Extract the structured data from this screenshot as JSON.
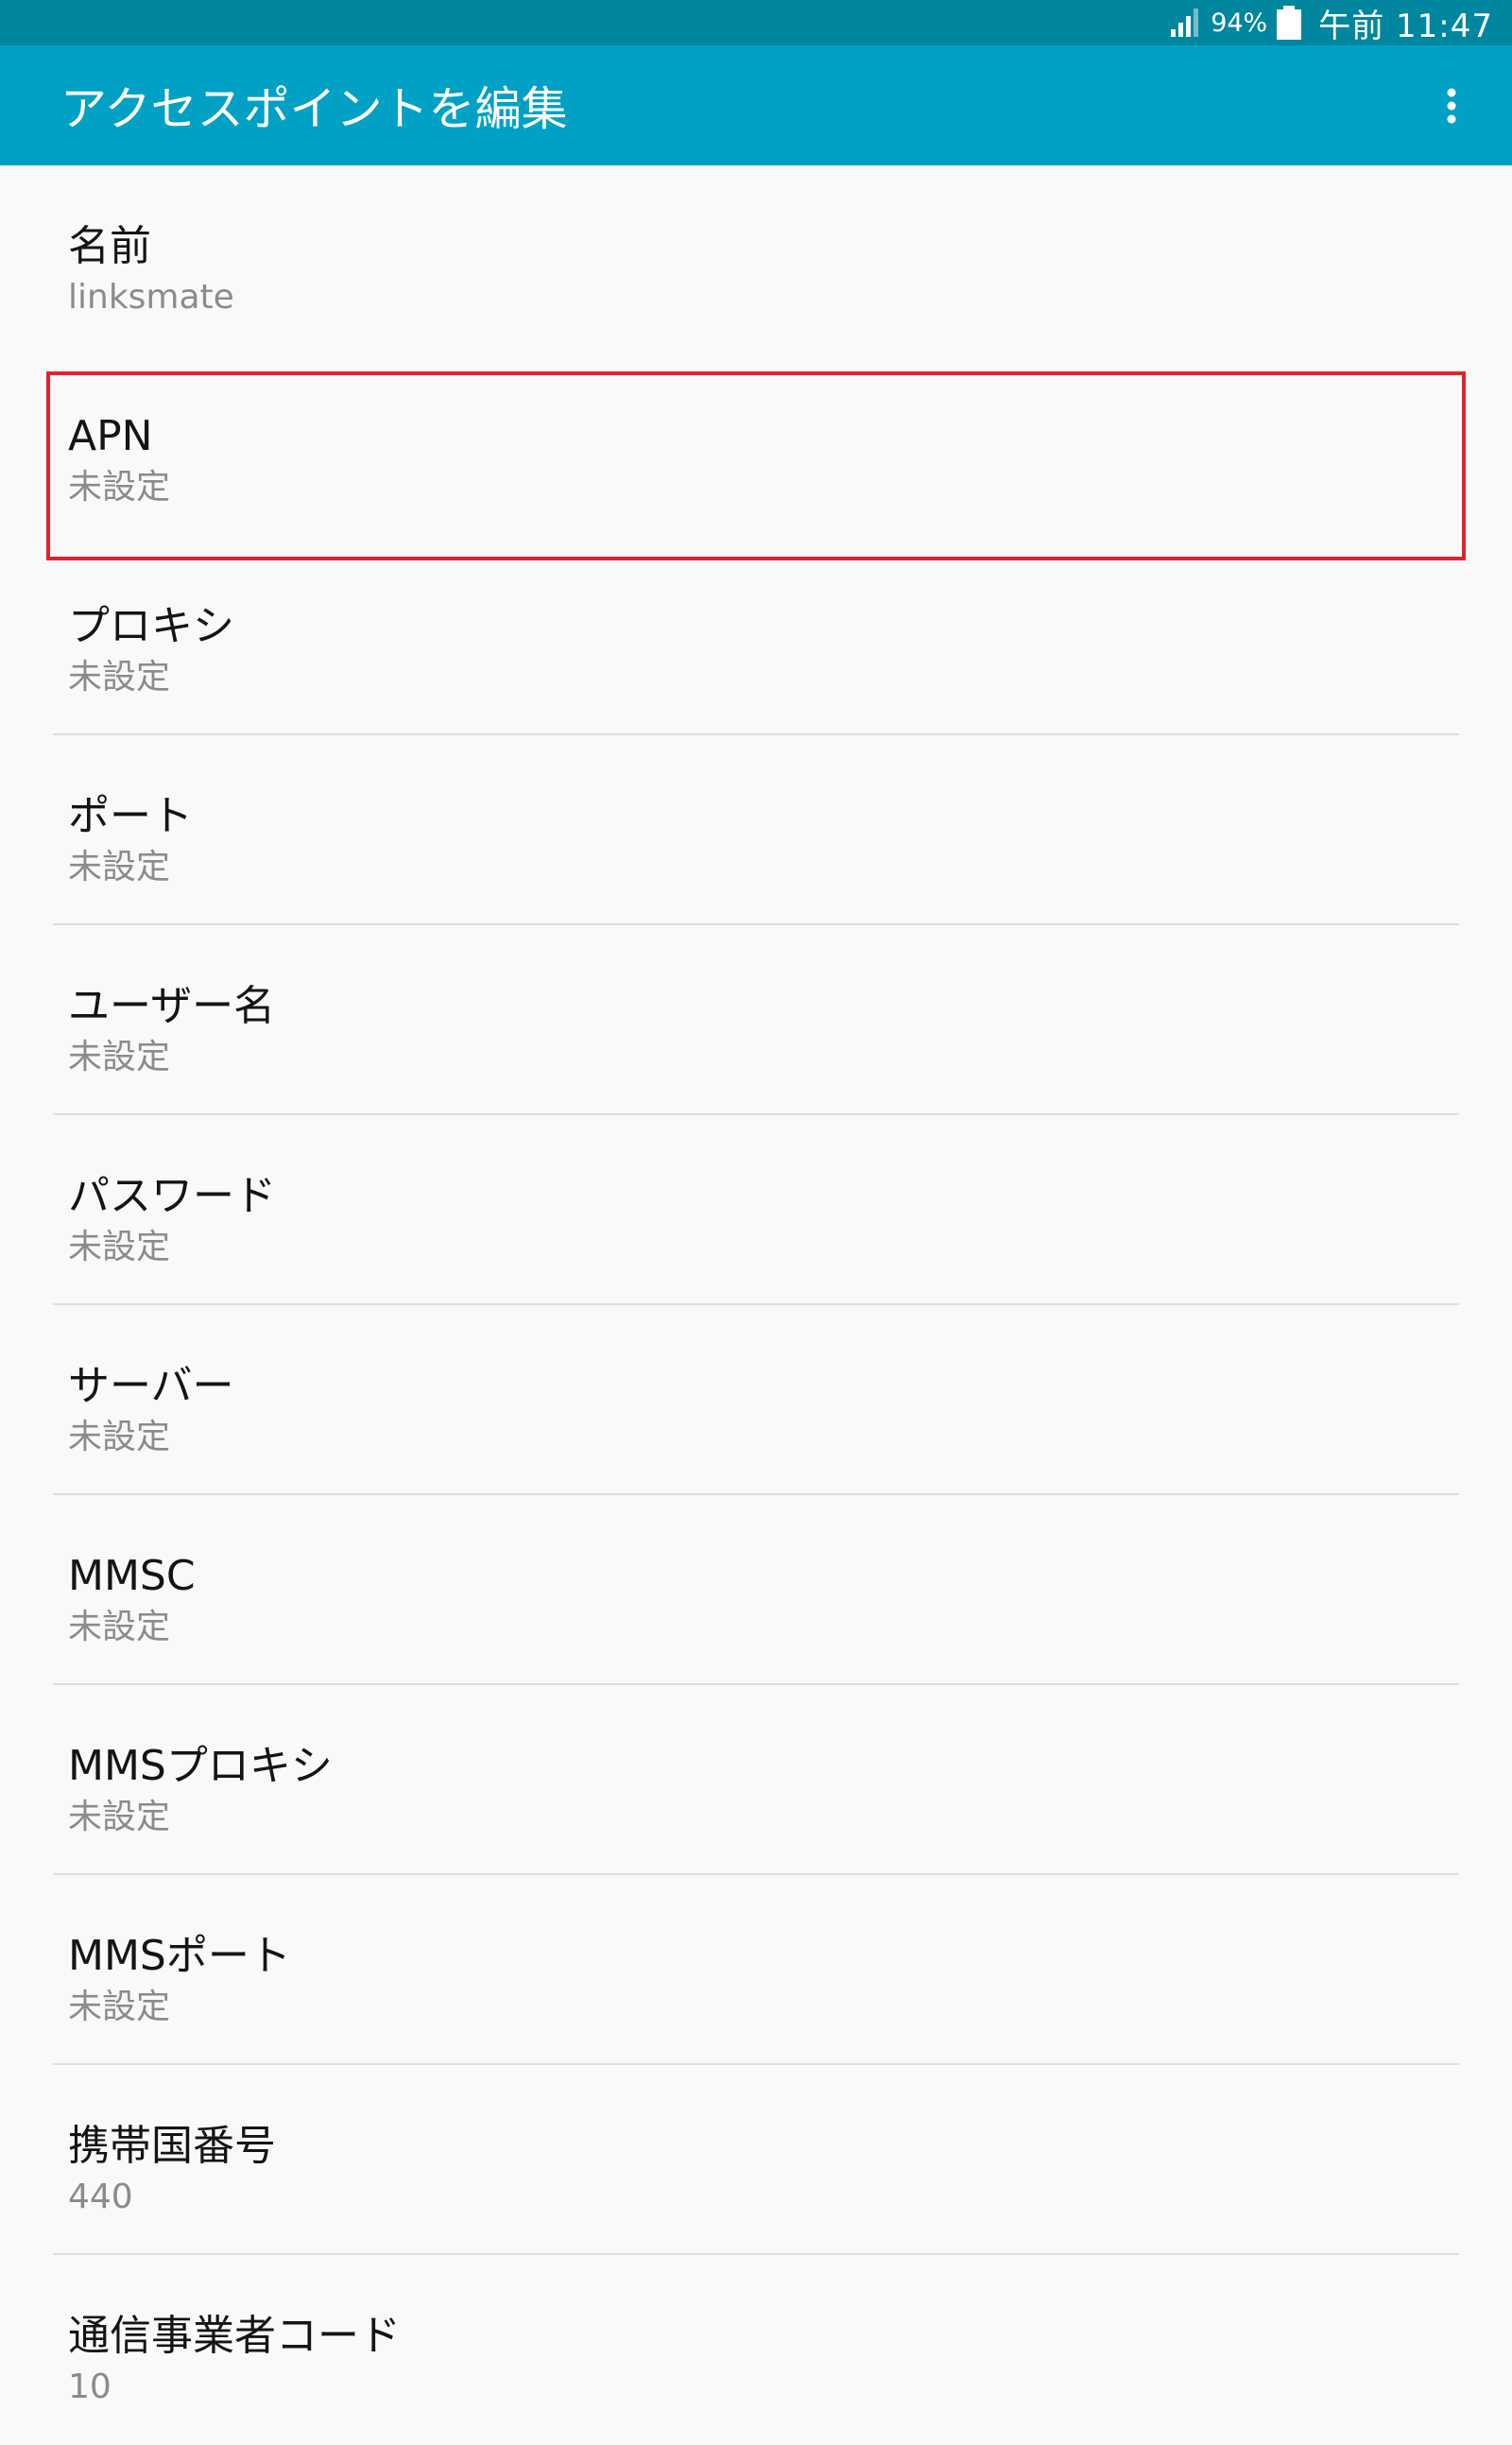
{
  "status_bar": {
    "battery_percent": "94%",
    "clock": "午前 11:47",
    "signal_icon": "signal-icon",
    "battery_icon": "battery-icon"
  },
  "app_bar": {
    "title": "アクセスポイントを編集",
    "overflow_icon": "more-vert-icon"
  },
  "colors": {
    "status_bar": "#00869e",
    "app_bar": "#00a1c4",
    "background": "#f9f9f9",
    "highlight": "#e3222c",
    "label": "#141414",
    "value": "#8b8b8b"
  },
  "settings": [
    {
      "label": "名前",
      "value": "linksmate"
    },
    {
      "label": "APN",
      "value": "未設定"
    },
    {
      "label": "プロキシ",
      "value": "未設定"
    },
    {
      "label": "ポート",
      "value": "未設定"
    },
    {
      "label": "ユーザー名",
      "value": "未設定"
    },
    {
      "label": "パスワード",
      "value": "未設定"
    },
    {
      "label": "サーバー",
      "value": "未設定"
    },
    {
      "label": "MMSC",
      "value": "未設定"
    },
    {
      "label": "MMSプロキシ",
      "value": "未設定"
    },
    {
      "label": "MMSポート",
      "value": "未設定"
    },
    {
      "label": "携帯国番号",
      "value": "440"
    },
    {
      "label": "通信事業者コード",
      "value": "10"
    }
  ]
}
